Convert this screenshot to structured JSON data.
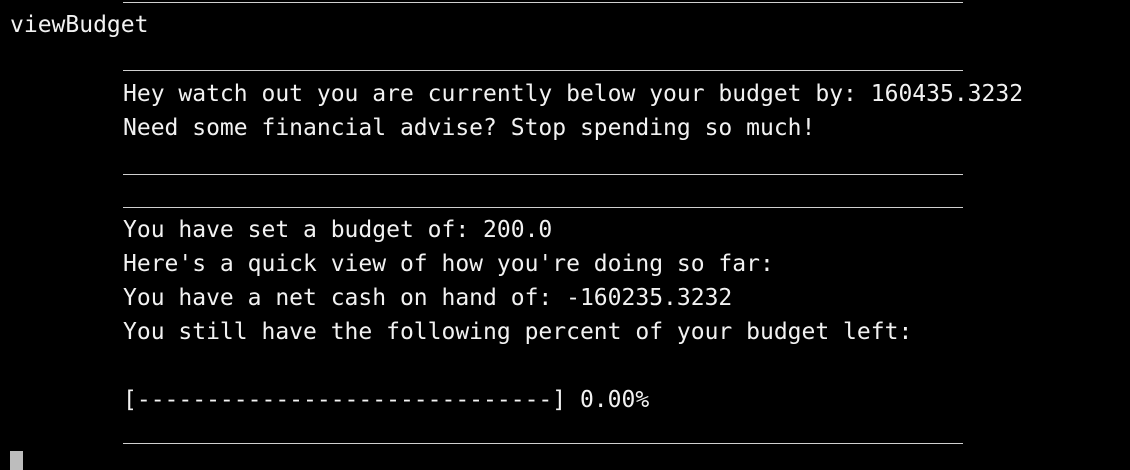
{
  "terminal": {
    "command": "viewBudget",
    "warning_line": "Hey watch out you are currently below your budget by: 160435.3232",
    "advice_line": "Need some financial advise? Stop spending so much!",
    "budget_line": "You have set a budget of: 200.0",
    "quick_view_line": "Here's a quick view of how you're doing so far:",
    "net_cash_line": "You have a net cash on hand of: -160235.3232",
    "percent_left_line": "You still have the following percent of your budget left:",
    "progress_bar_text": "[------------------------------] 0.00%",
    "budget_left_percent": 0.0
  }
}
